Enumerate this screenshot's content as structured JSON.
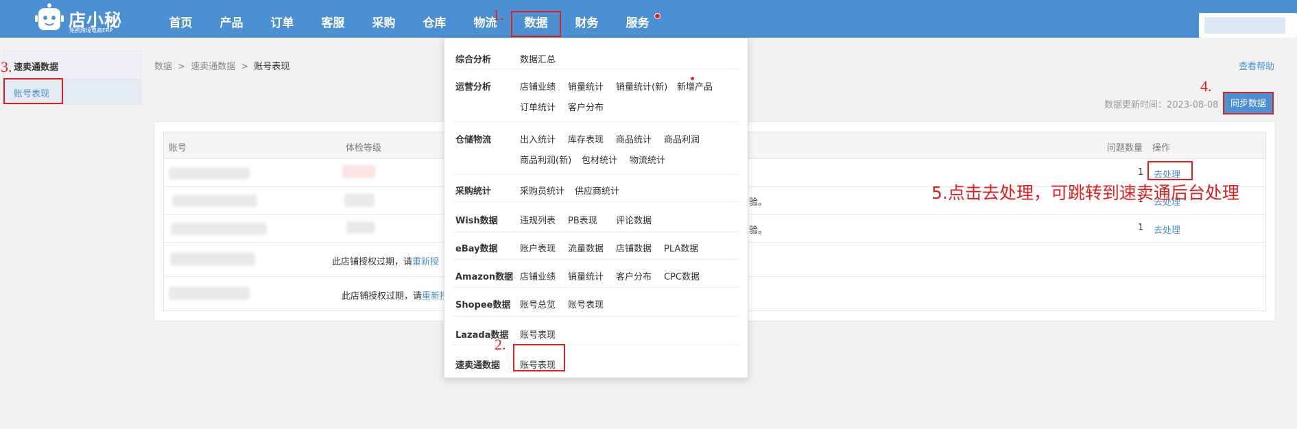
{
  "topbar": {
    "logo": {
      "title": "店小秘",
      "subtitle": "免费跨境电商ERP"
    },
    "nav": [
      {
        "label": "首页"
      },
      {
        "label": "产品"
      },
      {
        "label": "订单"
      },
      {
        "label": "客服"
      },
      {
        "label": "采购"
      },
      {
        "label": "仓库"
      },
      {
        "label": "物流"
      },
      {
        "label": "数据",
        "active": true
      },
      {
        "label": "财务"
      },
      {
        "label": "服务",
        "has_dot": true
      }
    ]
  },
  "sidebar": {
    "title": "速卖通数据",
    "items": [
      {
        "label": "账号表现",
        "active": true
      }
    ]
  },
  "breadcrumb": {
    "items": [
      "数据",
      "速卖通数据",
      "账号表现"
    ],
    "separator": ">"
  },
  "header": {
    "help_link": "查看帮助",
    "update_label": "数据更新时间：",
    "update_date": "2023-08-08",
    "sync_button": "同步数据"
  },
  "table": {
    "columns": {
      "account": "账号",
      "level": "体检等级",
      "issues": "问题数量",
      "actions": "操作"
    },
    "rows": [
      {
        "partial_text": "",
        "issues": "1",
        "action": "去处理"
      },
      {
        "partial_text": "验。",
        "issues": "1",
        "action": "去处理"
      },
      {
        "partial_text": "验。",
        "issues": "1",
        "action": "去处理"
      },
      {
        "auth_text": "此店铺授权过期，请",
        "auth_link": "重新授"
      },
      {
        "auth_text": "此店铺授权过期，请",
        "auth_link": "重新授"
      }
    ]
  },
  "dropdown": {
    "sections": [
      {
        "category": "综合分析",
        "lines": [
          [
            "数据汇总"
          ]
        ]
      },
      {
        "category": "运营分析",
        "lines": [
          [
            "店铺业绩",
            "销量统计",
            "销量统计(新)",
            "新增产品"
          ],
          [
            "订单统计",
            "客户分布"
          ]
        ]
      },
      {
        "category": "仓储物流",
        "lines": [
          [
            "出入统计",
            "库存表现",
            "商品统计",
            "商品利润"
          ],
          [
            "商品利润(新)",
            "包材统计",
            "物流统计"
          ]
        ]
      },
      {
        "category": "采购统计",
        "lines": [
          [
            "采购员统计",
            "供应商统计"
          ]
        ]
      },
      {
        "category": "Wish数据",
        "lines": [
          [
            "违规列表",
            "PB表现",
            "评论数据"
          ]
        ]
      },
      {
        "category": "eBay数据",
        "lines": [
          [
            "账户表现",
            "流量数据",
            "店铺数据",
            "PLA数据"
          ]
        ]
      },
      {
        "category": "Amazon数据",
        "lines": [
          [
            "店铺业绩",
            "销量统计",
            "客户分布",
            "CPC数据"
          ]
        ]
      },
      {
        "category": "Shopee数据",
        "lines": [
          [
            "账号总览",
            "账号表现"
          ]
        ]
      },
      {
        "category": "Lazada数据",
        "lines": [
          [
            "账号表现"
          ]
        ]
      },
      {
        "category": "速卖通数据",
        "lines": [
          [
            "账号表现"
          ]
        ]
      }
    ]
  },
  "annotations": {
    "step1": "1.",
    "step2": "2.",
    "step3": "3.",
    "step4": "4.",
    "step5": "5.点击去处理，可跳转到速卖通后台处理"
  },
  "colors": {
    "brand": "#4a90d2",
    "annotation": "#e02020",
    "link": "#4a90d2"
  }
}
